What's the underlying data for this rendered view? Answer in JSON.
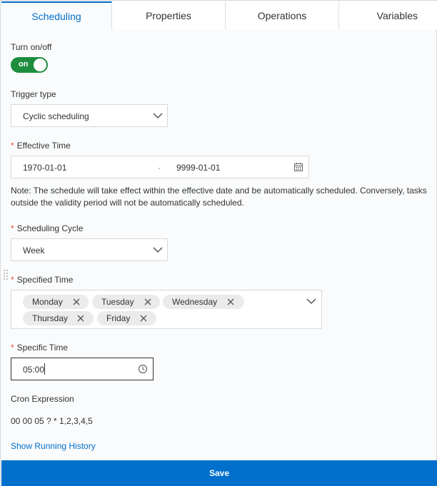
{
  "tabs": [
    {
      "label": "Scheduling",
      "active": true
    },
    {
      "label": "Properties",
      "active": false
    },
    {
      "label": "Operations",
      "active": false
    },
    {
      "label": "Variables",
      "active": false
    }
  ],
  "turn_on_off": {
    "label": "Turn on/off",
    "state_text": "on",
    "enabled": true,
    "color": "#1e8e3e"
  },
  "trigger_type": {
    "label": "Trigger type",
    "value": "Cyclic scheduling"
  },
  "effective_time": {
    "label": "Effective Time",
    "required": "*",
    "start": "1970-01-01",
    "separator": "-",
    "end": "9999-01-01",
    "icon": "calendar-icon"
  },
  "note": "Note: The schedule will take effect within the effective date and be automatically scheduled. Conversely, tasks outside the validity period will not be automatically scheduled.",
  "scheduling_cycle": {
    "label": "Scheduling Cycle",
    "required": "*",
    "value": "Week"
  },
  "specified_time": {
    "label": "Specified Time",
    "required": "*",
    "tags": [
      "Monday",
      "Tuesday",
      "Wednesday",
      "Thursday",
      "Friday"
    ]
  },
  "specific_time": {
    "label": "Specific Time",
    "required": "*",
    "value": "05:00",
    "icon": "clock-icon"
  },
  "cron": {
    "label": "Cron Expression",
    "value": "00 00 05 ? * 1,2,3,4,5"
  },
  "history_link": "Show Running History",
  "save_label": "Save",
  "colors": {
    "accent": "#0070cc",
    "required": "#e84738",
    "toggle_on": "#1e8e3e"
  }
}
